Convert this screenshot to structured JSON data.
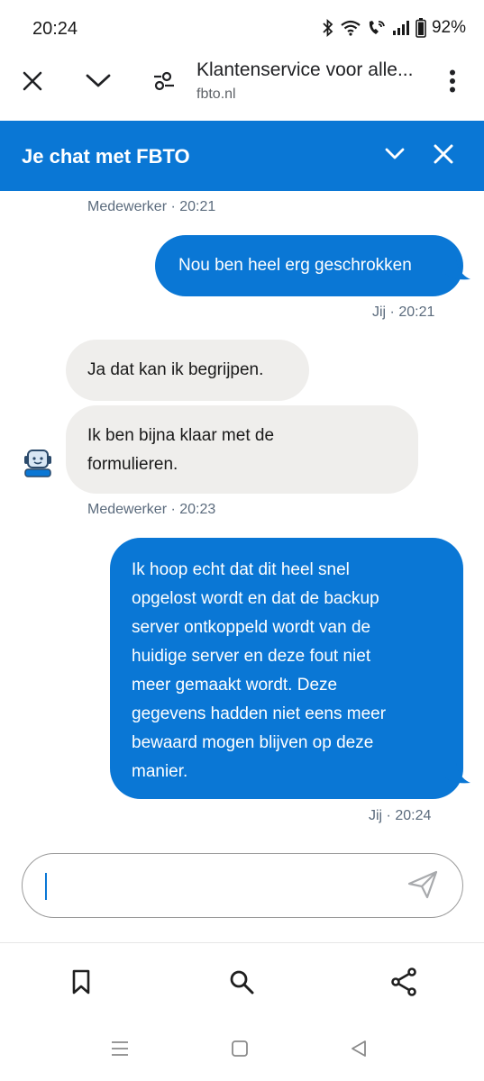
{
  "status_bar": {
    "time": "20:24",
    "battery": "92%",
    "icons": [
      "bluetooth-icon",
      "wifi-icon",
      "wifi-calling-icon",
      "signal-icon",
      "battery-icon"
    ]
  },
  "browser": {
    "page_title": "Klantenservice voor alle...",
    "domain": "fbto.nl",
    "icons": [
      "close-icon",
      "chevron-down-icon",
      "site-settings-icon",
      "more-vert-icon"
    ]
  },
  "chat_header": {
    "title": "Je chat met FBTO",
    "accent_color": "#0a77d5"
  },
  "messages": [
    {
      "meta": "Medewerker · 20:21"
    },
    {
      "sender": "user",
      "text": "Nou ben heel erg geschrokken",
      "meta": "Jij · 20:21"
    },
    {
      "sender": "agent",
      "text": "Ja dat kan ik begrijpen."
    },
    {
      "sender": "agent",
      "lines": [
        "Ik ben bijna klaar met de",
        "formulieren."
      ],
      "meta": "Medewerker · 20:23"
    },
    {
      "sender": "user",
      "lines": [
        "Ik hoop echt dat dit heel snel",
        "opgelost wordt en dat de backup",
        "server ontkoppeld wordt van de",
        "huidige server en deze fout niet",
        "meer gemaakt wordt. Deze",
        "gegevens hadden niet eens meer",
        "bewaard mogen blijven op deze",
        "manier."
      ],
      "meta": "Jij · 20:24"
    }
  ],
  "composer": {
    "value": "",
    "placeholder": "",
    "send_icon": "send-icon"
  },
  "bottom_toolbar": {
    "icons": [
      "bookmark-icon",
      "search-icon",
      "share-icon"
    ]
  },
  "nav_bar": {
    "icons": [
      "recent-apps-icon",
      "home-icon",
      "back-icon"
    ]
  }
}
